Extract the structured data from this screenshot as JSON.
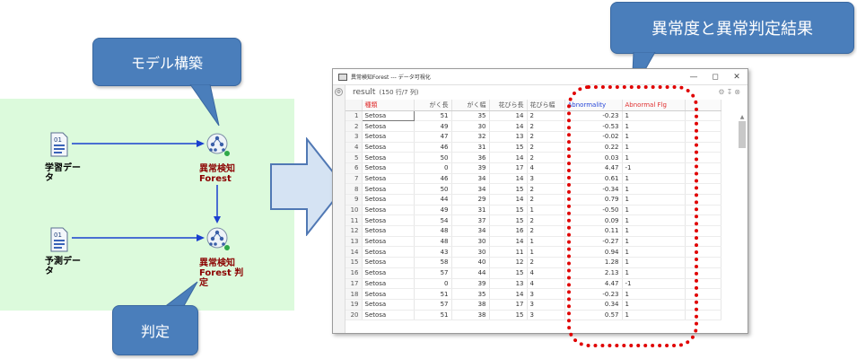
{
  "callouts": {
    "model": "モデル構築",
    "judge": "判定",
    "result": "異常度と異常判定結果"
  },
  "flow": {
    "train_label": "学習データ",
    "predict_label": "予測データ",
    "node_build": "異常検知\nForest",
    "node_judge": "異常検知\nForest 判\n定",
    "file_icon_text": "01"
  },
  "window": {
    "title": "異常検知Forest --- データ可視化",
    "result_label": "result",
    "result_count": "(150 行/7 列)"
  },
  "table": {
    "headers": [
      "種類",
      "がく長",
      "がく幅",
      "花びら長",
      "花びら幅",
      "Abnormality",
      "Abnormal Flg"
    ],
    "rows": [
      [
        "1",
        "Setosa",
        "51",
        "35",
        "14",
        "2",
        "-0.23",
        "1"
      ],
      [
        "2",
        "Setosa",
        "49",
        "30",
        "14",
        "2",
        "-0.53",
        "1"
      ],
      [
        "3",
        "Setosa",
        "47",
        "32",
        "13",
        "2",
        "-0.02",
        "1"
      ],
      [
        "4",
        "Setosa",
        "46",
        "31",
        "15",
        "2",
        "0.22",
        "1"
      ],
      [
        "5",
        "Setosa",
        "50",
        "36",
        "14",
        "2",
        "0.03",
        "1"
      ],
      [
        "6",
        "Setosa",
        "0",
        "39",
        "17",
        "4",
        "4.47",
        "-1"
      ],
      [
        "7",
        "Setosa",
        "46",
        "34",
        "14",
        "3",
        "0.61",
        "1"
      ],
      [
        "8",
        "Setosa",
        "50",
        "34",
        "15",
        "2",
        "-0.34",
        "1"
      ],
      [
        "9",
        "Setosa",
        "44",
        "29",
        "14",
        "2",
        "0.79",
        "1"
      ],
      [
        "10",
        "Setosa",
        "49",
        "31",
        "15",
        "1",
        "-0.50",
        "1"
      ],
      [
        "11",
        "Setosa",
        "54",
        "37",
        "15",
        "2",
        "0.09",
        "1"
      ],
      [
        "12",
        "Setosa",
        "48",
        "34",
        "16",
        "2",
        "0.11",
        "1"
      ],
      [
        "13",
        "Setosa",
        "48",
        "30",
        "14",
        "1",
        "-0.27",
        "1"
      ],
      [
        "14",
        "Setosa",
        "43",
        "30",
        "11",
        "1",
        "0.94",
        "1"
      ],
      [
        "15",
        "Setosa",
        "58",
        "40",
        "12",
        "2",
        "1.28",
        "1"
      ],
      [
        "16",
        "Setosa",
        "57",
        "44",
        "15",
        "4",
        "2.13",
        "1"
      ],
      [
        "17",
        "Setosa",
        "0",
        "39",
        "13",
        "4",
        "4.47",
        "-1"
      ],
      [
        "18",
        "Setosa",
        "51",
        "35",
        "14",
        "3",
        "-0.23",
        "1"
      ],
      [
        "19",
        "Setosa",
        "57",
        "38",
        "17",
        "3",
        "0.34",
        "1"
      ],
      [
        "20",
        "Setosa",
        "51",
        "38",
        "15",
        "3",
        "0.57",
        "1"
      ]
    ]
  },
  "colors": {
    "callout": "#4a7ebb",
    "flow_bg": "#dcfadc",
    "arrow": "#1a3fcf",
    "highlight": "#e00000"
  }
}
